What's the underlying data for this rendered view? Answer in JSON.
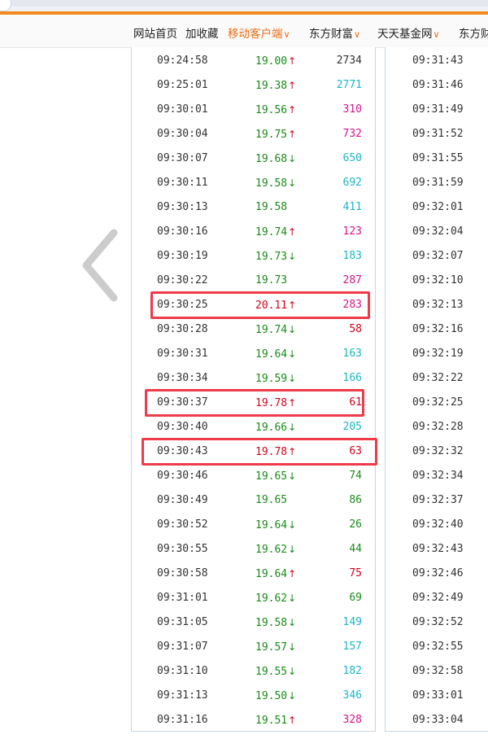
{
  "nav": {
    "items": [
      {
        "label": "网站首页",
        "accent": false,
        "chevron": false
      },
      {
        "label": "加收藏",
        "accent": false,
        "chevron": false
      },
      {
        "label": "移动客户端",
        "accent": true,
        "chevron": true
      },
      {
        "label": "东方财富",
        "accent": false,
        "chevron": true
      },
      {
        "label": "天天基金网",
        "accent": false,
        "chevron": true
      },
      {
        "label": "东方财",
        "accent": false,
        "chevron": false
      }
    ]
  },
  "colors": {
    "up": "#d0021b",
    "down": "#1a8a1a",
    "cyan": "#1cb5c8",
    "magenta": "#d4148c",
    "highlight": "#ef3a4a",
    "accent": "#ea6b10"
  },
  "left_rows": [
    {
      "time": "09:24:58",
      "price": "19.00",
      "dir": "up",
      "vol": "2734",
      "price_color": "green",
      "vol_color": "dark"
    },
    {
      "time": "09:25:01",
      "price": "19.38",
      "dir": "up",
      "vol": "2771",
      "price_color": "green",
      "vol_color": "cyan"
    },
    {
      "time": "09:30:01",
      "price": "19.56",
      "dir": "up",
      "vol": "310",
      "price_color": "green",
      "vol_color": "magenta"
    },
    {
      "time": "09:30:04",
      "price": "19.75",
      "dir": "up",
      "vol": "732",
      "price_color": "green",
      "vol_color": "magenta"
    },
    {
      "time": "09:30:07",
      "price": "19.68",
      "dir": "down",
      "vol": "650",
      "price_color": "green",
      "vol_color": "cyan"
    },
    {
      "time": "09:30:11",
      "price": "19.58",
      "dir": "down",
      "vol": "692",
      "price_color": "green",
      "vol_color": "cyan"
    },
    {
      "time": "09:30:13",
      "price": "19.58",
      "dir": "",
      "vol": "411",
      "price_color": "green",
      "vol_color": "cyan"
    },
    {
      "time": "09:30:16",
      "price": "19.74",
      "dir": "up",
      "vol": "123",
      "price_color": "green",
      "vol_color": "magenta"
    },
    {
      "time": "09:30:19",
      "price": "19.73",
      "dir": "down",
      "vol": "183",
      "price_color": "green",
      "vol_color": "cyan"
    },
    {
      "time": "09:30:22",
      "price": "19.73",
      "dir": "",
      "vol": "287",
      "price_color": "green",
      "vol_color": "magenta"
    },
    {
      "time": "09:30:25",
      "price": "20.11",
      "dir": "up",
      "vol": "283",
      "price_color": "red",
      "vol_color": "magenta",
      "highlight": true
    },
    {
      "time": "09:30:28",
      "price": "19.74",
      "dir": "down",
      "vol": "58",
      "price_color": "green",
      "vol_color": "red"
    },
    {
      "time": "09:30:31",
      "price": "19.64",
      "dir": "down",
      "vol": "163",
      "price_color": "green",
      "vol_color": "cyan"
    },
    {
      "time": "09:30:34",
      "price": "19.59",
      "dir": "down",
      "vol": "166",
      "price_color": "green",
      "vol_color": "cyan"
    },
    {
      "time": "09:30:37",
      "price": "19.78",
      "dir": "up",
      "vol": "61",
      "price_color": "red",
      "vol_color": "red",
      "highlight": true
    },
    {
      "time": "09:30:40",
      "price": "19.66",
      "dir": "down",
      "vol": "205",
      "price_color": "green",
      "vol_color": "cyan"
    },
    {
      "time": "09:30:43",
      "price": "19.78",
      "dir": "up",
      "vol": "63",
      "price_color": "red",
      "vol_color": "red",
      "highlight": true
    },
    {
      "time": "09:30:46",
      "price": "19.65",
      "dir": "down",
      "vol": "74",
      "price_color": "green",
      "vol_color": "green"
    },
    {
      "time": "09:30:49",
      "price": "19.65",
      "dir": "",
      "vol": "86",
      "price_color": "green",
      "vol_color": "green"
    },
    {
      "time": "09:30:52",
      "price": "19.64",
      "dir": "down",
      "vol": "26",
      "price_color": "green",
      "vol_color": "green"
    },
    {
      "time": "09:30:55",
      "price": "19.62",
      "dir": "down",
      "vol": "44",
      "price_color": "green",
      "vol_color": "green"
    },
    {
      "time": "09:30:58",
      "price": "19.64",
      "dir": "up",
      "vol": "75",
      "price_color": "green",
      "vol_color": "red"
    },
    {
      "time": "09:31:01",
      "price": "19.62",
      "dir": "down",
      "vol": "69",
      "price_color": "green",
      "vol_color": "green"
    },
    {
      "time": "09:31:05",
      "price": "19.58",
      "dir": "down",
      "vol": "149",
      "price_color": "green",
      "vol_color": "cyan"
    },
    {
      "time": "09:31:07",
      "price": "19.57",
      "dir": "down",
      "vol": "157",
      "price_color": "green",
      "vol_color": "cyan"
    },
    {
      "time": "09:31:10",
      "price": "19.55",
      "dir": "down",
      "vol": "182",
      "price_color": "green",
      "vol_color": "cyan"
    },
    {
      "time": "09:31:13",
      "price": "19.50",
      "dir": "down",
      "vol": "346",
      "price_color": "green",
      "vol_color": "cyan"
    },
    {
      "time": "09:31:16",
      "price": "19.51",
      "dir": "up",
      "vol": "328",
      "price_color": "green",
      "vol_color": "magenta"
    }
  ],
  "right_rows": [
    "09:31:43",
    "09:31:46",
    "09:31:49",
    "09:31:52",
    "09:31:55",
    "09:31:59",
    "09:32:01",
    "09:32:04",
    "09:32:07",
    "09:32:10",
    "09:32:13",
    "09:32:16",
    "09:32:19",
    "09:32:22",
    "09:32:25",
    "09:32:28",
    "09:32:32",
    "09:32:34",
    "09:32:37",
    "09:32:40",
    "09:32:43",
    "09:32:46",
    "09:32:49",
    "09:32:52",
    "09:32:55",
    "09:32:58",
    "09:33:01",
    "09:33:04"
  ],
  "icons": {
    "prev": "chevron-left-icon",
    "up": "arrow-up-icon",
    "down": "arrow-down-icon"
  }
}
